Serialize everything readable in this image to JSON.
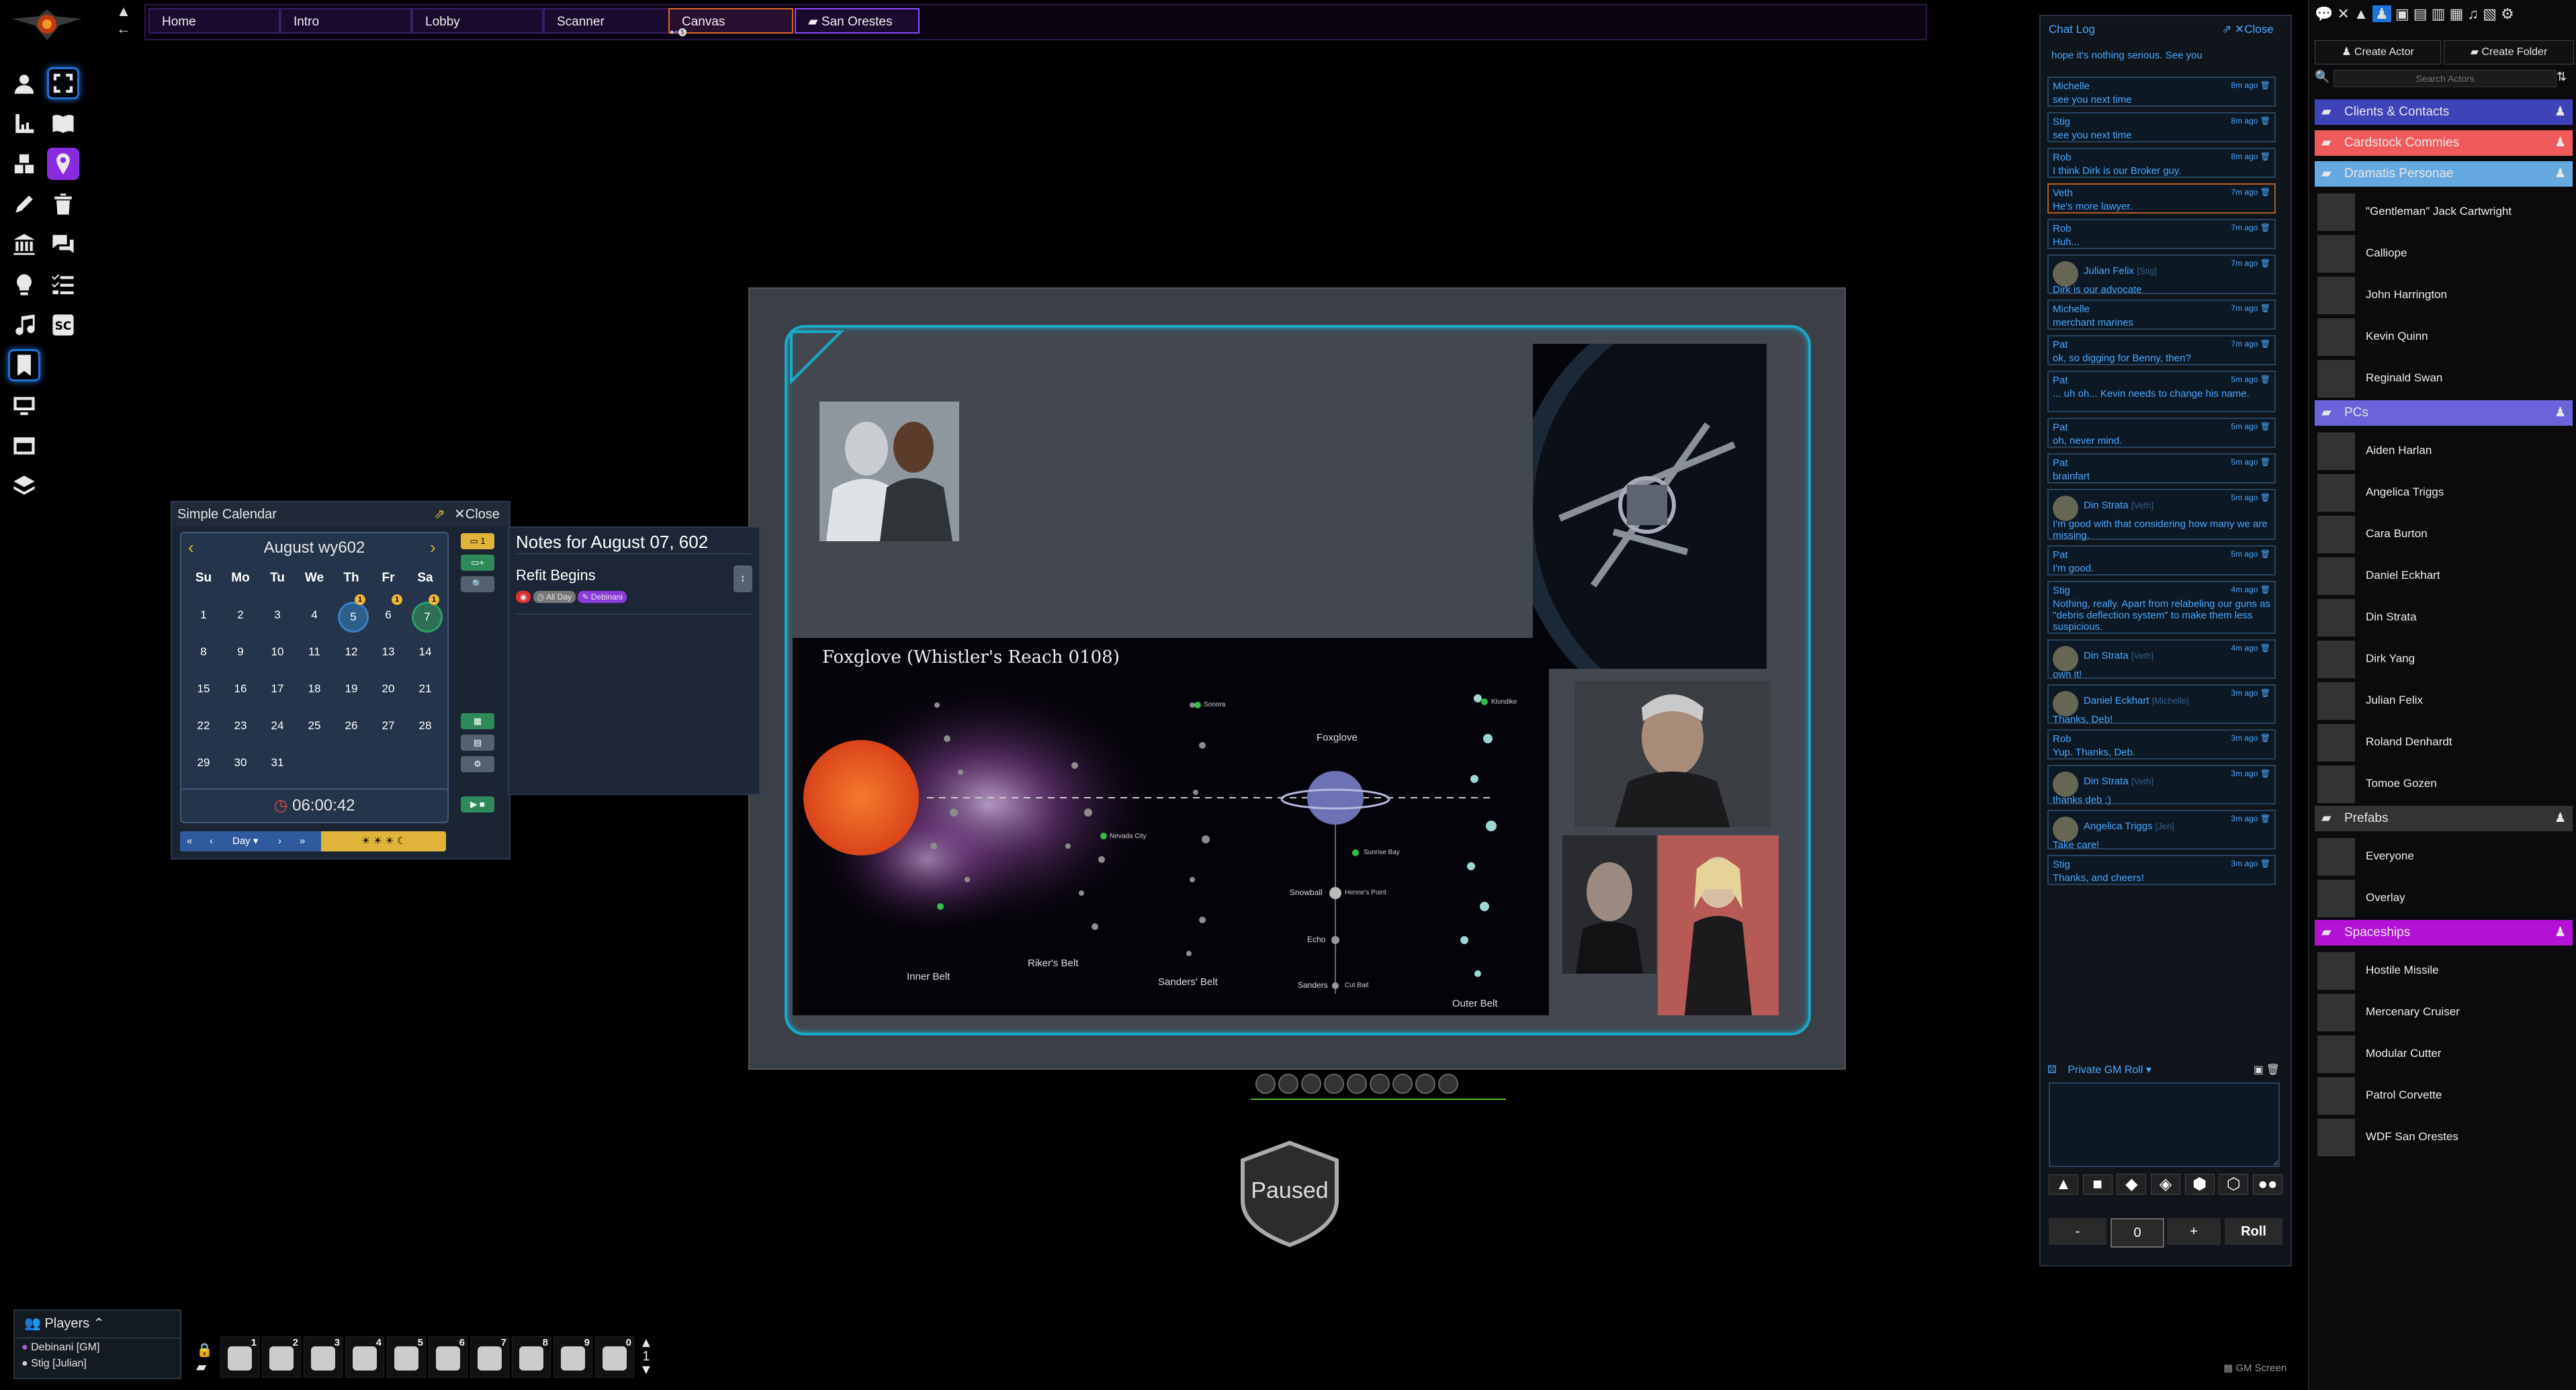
{
  "scene_nav": {
    "tabs": [
      {
        "label": "Home"
      },
      {
        "label": "Intro"
      },
      {
        "label": "Lobby"
      },
      {
        "label": "Scanner"
      },
      {
        "label": "Canvas",
        "active": true
      },
      {
        "label": "San Orestes",
        "folder": true
      }
    ],
    "canvas_users": "5"
  },
  "map": {
    "title": "Foxglove (Whistler's Reach 0108)",
    "labels": {
      "inner_belt": "Inner Belt",
      "rikers_belt": "Riker's Belt",
      "sanders_belt": "Sanders' Belt",
      "outer_belt": "Outer Belt",
      "foxglove": "Foxglove",
      "snowball": "Snowball",
      "echo": "Echo",
      "sanders": "Sanders",
      "sunrise_bay": "Sunrise Bay",
      "nevada_city": "Nevada City",
      "sonora": "Sonora",
      "klondike": "Klondike",
      "hennes_point": "Henne's Point",
      "cut_bait": "Cut Bait"
    }
  },
  "calendar": {
    "title": "Simple Calendar",
    "close_label": "Close",
    "month_label": "August wy602",
    "weekdays": [
      "Su",
      "Mo",
      "Tu",
      "We",
      "Th",
      "Fr",
      "Sa"
    ],
    "weeks": [
      [
        "1",
        "2",
        "3",
        "4",
        "5",
        "6",
        "7"
      ],
      [
        "8",
        "9",
        "10",
        "11",
        "12",
        "13",
        "14"
      ],
      [
        "15",
        "16",
        "17",
        "18",
        "19",
        "20",
        "21"
      ],
      [
        "22",
        "23",
        "24",
        "25",
        "26",
        "27",
        "28"
      ],
      [
        "29",
        "30",
        "31",
        "",
        "",
        "",
        "",
        ""
      ]
    ],
    "badges": {
      "th1": "1",
      "fr1": "1",
      "sa1": "1"
    },
    "clock": "06:00:42",
    "step_label": "Day",
    "notes_count": "1",
    "notes": {
      "heading": "Notes for August 07, 602",
      "entry_title": "Refit Begins",
      "tag_all_day": "All Day",
      "tag_author": "Debinani"
    }
  },
  "chat": {
    "title": "Chat Log",
    "close_label": "Close",
    "top_fragment": "hope it's nothing serious. See you",
    "messages": [
      {
        "author": "Michelle",
        "time": "8m ago",
        "text": "see you next time"
      },
      {
        "author": "Stig",
        "time": "8m ago",
        "text": "see you next time"
      },
      {
        "author": "Rob",
        "time": "8m ago",
        "text": "I think Dirk is our Broker guy."
      },
      {
        "author": "Veth",
        "time": "7m ago",
        "text": "He's more lawyer.",
        "whisper": true
      },
      {
        "author": "Rob",
        "time": "7m ago",
        "text": "Huh..."
      },
      {
        "author": "Julian Felix",
        "sub": "[Stig]",
        "time": "7m ago",
        "text": "Dirk is our advocate",
        "avatar": true
      },
      {
        "author": "Michelle",
        "time": "7m ago",
        "text": "merchant marines"
      },
      {
        "author": "Pat",
        "time": "7m ago",
        "text": "ok, so digging for Benny, then?"
      },
      {
        "author": "Pat",
        "time": "5m ago",
        "text": "... uh oh... Kevin needs to change his name."
      },
      {
        "author": "Pat",
        "time": "5m ago",
        "text": "oh, never mind."
      },
      {
        "author": "Pat",
        "time": "5m ago",
        "text": "brainfart"
      },
      {
        "author": "Din Strata",
        "sub": "[Veth]",
        "time": "5m ago",
        "text": "I'm good with that considering how many we are missing.",
        "avatar": true
      },
      {
        "author": "Pat",
        "time": "5m ago",
        "text": "I'm good."
      },
      {
        "author": "Stig",
        "time": "4m ago",
        "text": "Nothing, really. Apart from relabeling our guns as \"debris deflection system\" to make them less suspicious."
      },
      {
        "author": "Din Strata",
        "sub": "[Veth]",
        "time": "4m ago",
        "text": "own it!",
        "avatar": true
      },
      {
        "author": "Daniel Eckhart",
        "sub": "[Michelle]",
        "time": "3m ago",
        "text": "Thanks, Deb!",
        "avatar": true
      },
      {
        "author": "Rob",
        "time": "3m ago",
        "text": "Yup. Thanks, Deb."
      },
      {
        "author": "Din Strata",
        "sub": "[Veth]",
        "time": "3m ago",
        "text": "thanks deb :)",
        "avatar": true
      },
      {
        "author": "Angelica Triggs",
        "sub": "[Jen]",
        "time": "3m ago",
        "text": "Take care!",
        "avatar": true
      },
      {
        "author": "Stig",
        "time": "3m ago",
        "text": "Thanks, and cheers!"
      }
    ],
    "roll_mode": "Private GM Roll",
    "roll_value": "0",
    "minus_label": "-",
    "plus_label": "+",
    "roll_label": "Roll"
  },
  "actors": {
    "create_actor": "Create Actor",
    "create_folder": "Create Folder",
    "search_placeholder": "Search Actors",
    "folders": [
      {
        "name": "Clients & Contacts",
        "color": "#3e43b8"
      },
      {
        "name": "Cardstock Commies",
        "color": "#ef5b5b"
      },
      {
        "name": "Dramatis Personae",
        "color": "#66a9e0",
        "actors": [
          "\"Gentleman\" Jack Cartwright",
          "Calliope",
          "John Harrington",
          "Kevin Quinn",
          "Reginald Swan"
        ]
      },
      {
        "name": "PCs",
        "color": "#6a63d9",
        "actors": [
          "Aiden Harlan",
          "Angelica Triggs",
          "Cara Burton",
          "Daniel Eckhart",
          "Din Strata",
          "Dirk Yang",
          "Julian Felix",
          "Roland Denhardt",
          "Tomoe Gozen"
        ]
      },
      {
        "name": "Prefabs",
        "color": "#333333",
        "actors": [
          "Everyone",
          "Overlay"
        ]
      },
      {
        "name": "Spaceships",
        "color": "#b312d6",
        "actors": [
          "Hostile Missile",
          "Mercenary Cruiser",
          "Modular Cutter",
          "Patrol Corvette",
          "WDF San Orestes"
        ]
      }
    ]
  },
  "players": {
    "title": "Players",
    "list": [
      {
        "name": "Debinani [GM]",
        "color": "#b35bd9"
      },
      {
        "name": "Stig [Julian]",
        "color": "#cccccc"
      }
    ]
  },
  "hotbar": {
    "slots": [
      "1",
      "2",
      "3",
      "4",
      "5",
      "6",
      "7",
      "8",
      "9",
      "0"
    ],
    "page": "1"
  },
  "paused_label": "Paused",
  "gm_screen_label": "GM Screen"
}
